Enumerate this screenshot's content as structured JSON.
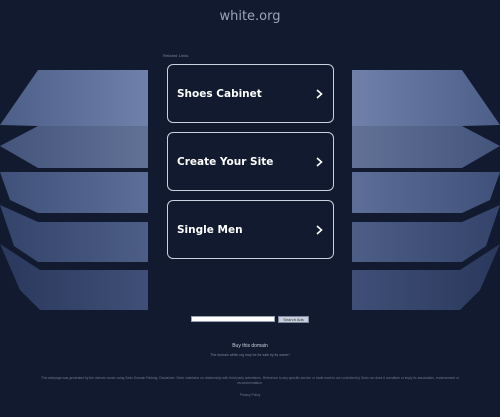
{
  "header": {
    "domain": "white.org"
  },
  "related": {
    "label": "Related Links",
    "links": [
      {
        "label": "Shoes Cabinet"
      },
      {
        "label": "Create Your Site"
      },
      {
        "label": "Single Men"
      }
    ]
  },
  "search": {
    "button_label": "Search Ads",
    "placeholder": ""
  },
  "footer": {
    "buy_link": "Buy this domain",
    "owner_note": "The domain white.org may be for sale by its owner!",
    "disclaimer": "This webpage was generated by the domain owner using Sedo Domain Parking. Disclaimer: Sedo maintains no relationship with third party advertisers. Reference to any specific service or trade mark is not controlled by Sedo nor does it constitute or imply its association, endorsement or recommendation.",
    "privacy": "Privacy Policy"
  },
  "colors": {
    "background": "#111a2e",
    "panel_light": "#6c7ea6",
    "panel_dark": "#2e3b5e",
    "box_border": "#c9d1df"
  }
}
